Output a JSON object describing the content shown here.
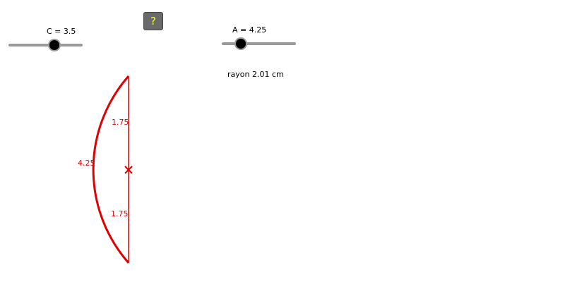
{
  "sliders": {
    "c": {
      "label": "C = 3.5",
      "value": 3.5
    },
    "a": {
      "label": "A = 4.25",
      "value": 4.25
    }
  },
  "help_button": {
    "label": "?"
  },
  "radius_text": "rayon 2.01 cm",
  "figure": {
    "color": "#e00000",
    "top_segment_label": "1.75",
    "bottom_segment_label": "1.75",
    "arc_label": "4.25",
    "center_marker": "cross-mark"
  },
  "colors": {
    "accent": "#e00000",
    "help_text": "#ffff33",
    "help_bg": "#6a6a6a",
    "track": "#9a9a9a"
  }
}
